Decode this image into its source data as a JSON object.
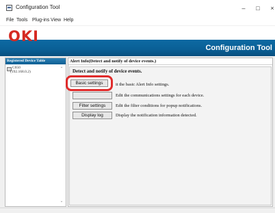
{
  "window": {
    "title": "Configuration Tool",
    "controls": {
      "minimize": "–",
      "maximize": "□",
      "close": "×"
    }
  },
  "menu": [
    "File",
    "Tools",
    "Plug-ins",
    "View",
    "Help"
  ],
  "brand": {
    "logo": "OKI",
    "title": "Configuration Tool"
  },
  "left_panel": {
    "header": "Registered Device Table",
    "device": {
      "name": "C650",
      "ip": "(192.168.0.2)"
    }
  },
  "right_panel": {
    "header": "Alert Info(Detect and notify of device events.)",
    "section_title": "Detect and notify of device events.",
    "actions": [
      {
        "label": "Basic settings",
        "description": "it the basic Alert Info settings."
      },
      {
        "label": "",
        "description": "Edit the communications settings for each device."
      },
      {
        "label": "Filter settings",
        "description": "Edit the filter conditions for popup notifications."
      },
      {
        "label": "Display log",
        "description": "Display the notification information detected."
      }
    ]
  },
  "colors": {
    "brand_blue": "#0d6aa3",
    "logo_red": "#d52a22",
    "highlight_red": "#e02b2b"
  }
}
